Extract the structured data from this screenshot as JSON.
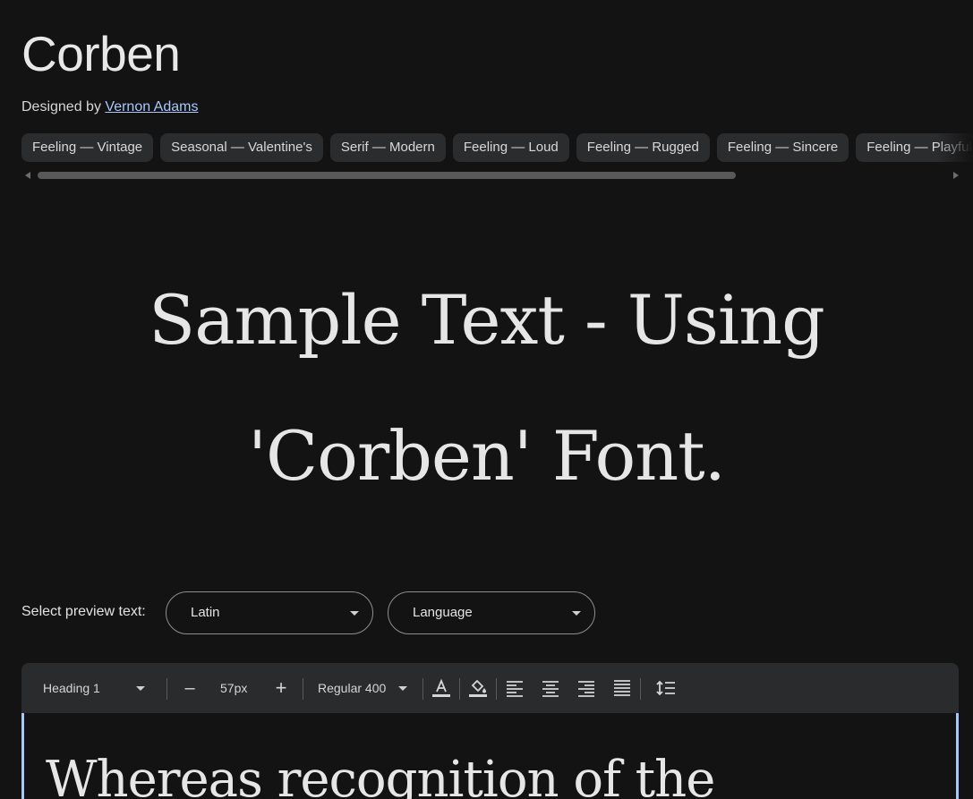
{
  "font": {
    "name": "Corben",
    "designed_by_prefix": "Designed by",
    "designer": "Vernon Adams"
  },
  "tags": [
    "Feeling — Vintage",
    "Seasonal — Valentine's",
    "Serif — Modern",
    "Feeling — Loud",
    "Feeling — Rugged",
    "Feeling — Sincere",
    "Feeling — Playful"
  ],
  "sample": {
    "line1": "Sample Text - Using",
    "line2": "'Corben' Font."
  },
  "preview": {
    "label": "Select preview text:",
    "script_select": "Latin",
    "language_select": "Language"
  },
  "toolbar": {
    "style_select": "Heading 1",
    "decrease_label": "–",
    "size_value": "57px",
    "increase_label": "+",
    "weight_select": "Regular 400"
  },
  "editor": {
    "text": "Whereas recognition of the"
  },
  "colors": {
    "background": "#131313",
    "chip": "#2b2c2e",
    "toolbar": "#2a2b2d",
    "link": "#a8c7fa",
    "editor_border": "#a8c7fa"
  },
  "icons": [
    "text-color-icon",
    "highlight-color-icon",
    "align-left-icon",
    "align-center-icon",
    "align-right-icon",
    "align-justify-icon",
    "line-height-icon"
  ]
}
